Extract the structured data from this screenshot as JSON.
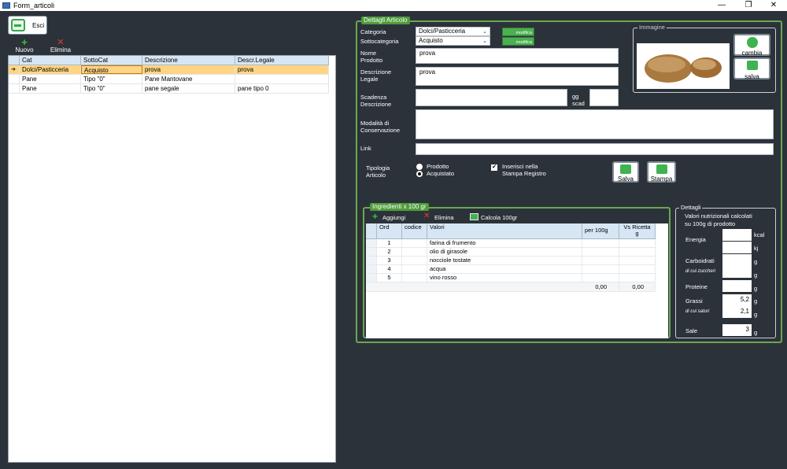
{
  "window": {
    "title": "Form_articoli",
    "min": "—",
    "restore": "❐",
    "close": "✕"
  },
  "toolbar": {
    "esci": "Esci",
    "nuovo": "Nuovo",
    "elimina": "Elimina"
  },
  "grid": {
    "columns": [
      "Cat",
      "SottoCat",
      "Descrizione",
      "Descr.Legale"
    ],
    "rows": [
      [
        "Dolci/Pasticceria",
        "Acquisto",
        "prova",
        "prova"
      ],
      [
        "Pane",
        "Tipo \"0\"",
        "Pane Mantovane",
        ""
      ],
      [
        "Pane",
        "Tipo \"0\"",
        "pane segale",
        "pane tipo 0"
      ]
    ],
    "selected_marker": "➔"
  },
  "dettagli": {
    "title": "Dettagli Articolo",
    "categoria_label": "Categoria",
    "categoria_value": "Dolci/Pasticceria",
    "sottocategoria_label": "Sottocategoria",
    "sottocategoria_value": "Acquisto",
    "modifica": "modifica",
    "nome_label_1": "Nome",
    "nome_label_2": "Prodotto",
    "nome_value": "prova",
    "descr_label_1": "Descrizione",
    "descr_label_2": "Legale",
    "descr_value": "prova",
    "scadenza_label_1": "Scadenza",
    "scadenza_label_2": "Descrizione",
    "gg_label_1": "gg",
    "gg_label_2": "scad",
    "modalita_label_1": "Modalità di",
    "modalita_label_2": "Conservazione",
    "link_label": "Link",
    "tipologia_label_1": "Tipologia",
    "tipologia_label_2": "Articolo",
    "radio_prodotto": "Prodotto",
    "radio_acquistato": "Acquistato",
    "check_label_1": "Inserisci nella",
    "check_label_2": "Stampa Registro",
    "salva": "Salva",
    "stampa": "Stampa"
  },
  "immagine": {
    "title": "Immagine",
    "cambia": "cambia",
    "salva": "salva"
  },
  "ingredienti": {
    "title": "Ingredienti x 100 gr",
    "aggiungi": "Aggiungi",
    "elimina": "Elimina",
    "calcola": "Calcola 100gr",
    "columns": [
      "Ord",
      "codice",
      "Valori",
      "per 100g",
      "Vs Ricetta g"
    ],
    "rows": [
      [
        "1",
        "",
        "farina di frumento",
        "",
        ""
      ],
      [
        "2",
        "",
        "olio di girasole",
        "",
        ""
      ],
      [
        "3",
        "",
        "nocciole tostate",
        "",
        ""
      ],
      [
        "4",
        "",
        "acqua",
        "",
        ""
      ],
      [
        "5",
        "",
        "vino rosso",
        "",
        ""
      ]
    ],
    "total_per100": "0,00",
    "total_ricetta": "0,00"
  },
  "nutrizione": {
    "title": "Dettagli",
    "subtitle_1": "Valori nutrizionali calcolati",
    "subtitle_2": "su 100g di prodotto",
    "energia": "Energia",
    "kcal": "kcal",
    "kj": "kj",
    "carboidrati": "Carboidrati",
    "zuccheri": "di cui zuccheri",
    "proteine": "Proteine",
    "grassi": "Grassi",
    "grassi_value": "5,2",
    "saturi": "di cui saturi",
    "saturi_value": "2,1",
    "sale": "Sale",
    "sale_value": "3",
    "g": "g"
  },
  "colors": {
    "accent": "#6aa84f",
    "background": "#2c323a",
    "selection": "#ffd585"
  }
}
